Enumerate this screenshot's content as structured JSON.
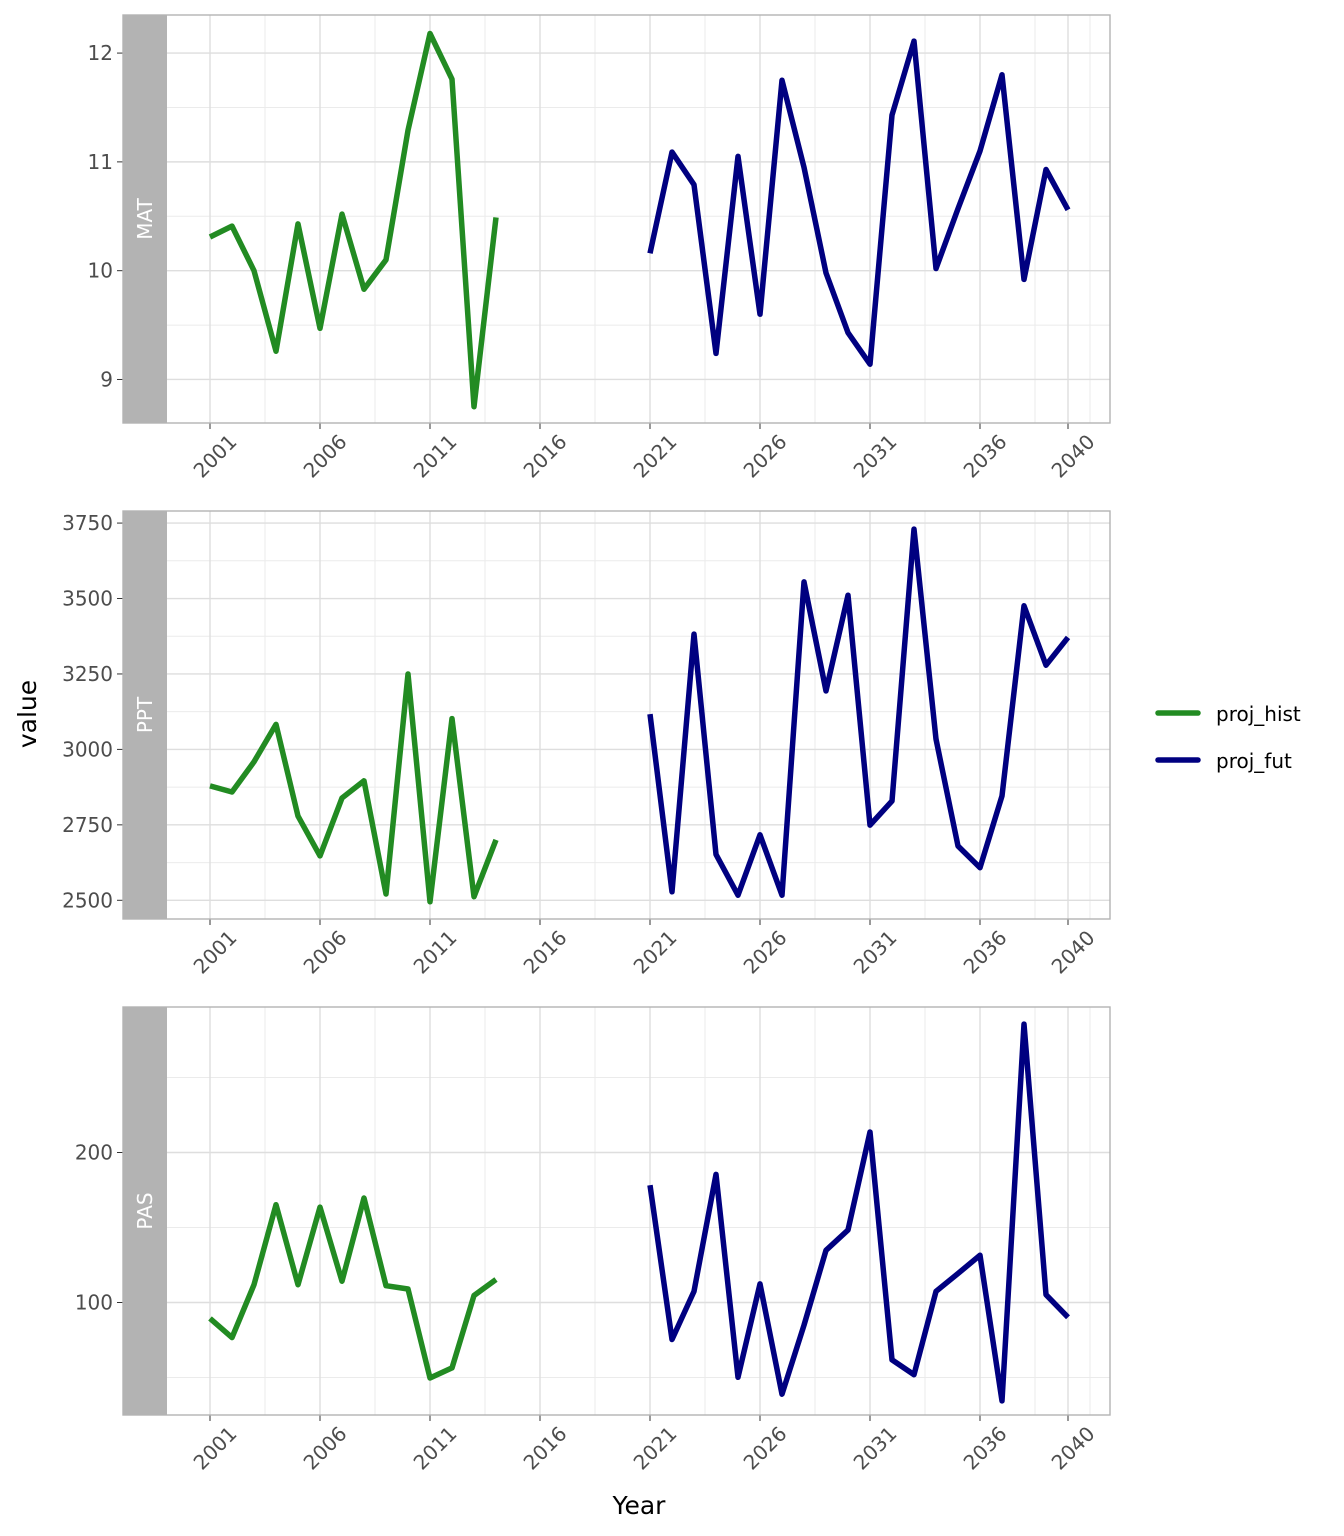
{
  "chart_data": {
    "type": "line",
    "facet_layout": "vertical",
    "xlabel": "Year",
    "ylabel": "value",
    "x_ticks": [
      2001,
      2006,
      2011,
      2016,
      2021,
      2026,
      2031,
      2036,
      2040
    ],
    "xlim": [
      1999,
      2041
    ],
    "grid": true,
    "legend": {
      "placement": "right",
      "entries": [
        {
          "name": "proj_hist",
          "color": "#228B22"
        },
        {
          "name": "proj_fut",
          "color": "#000080"
        }
      ]
    },
    "panels": [
      {
        "name": "MAT",
        "ylim": [
          8.6,
          12.35
        ],
        "y_ticks": [
          9,
          10,
          11,
          12
        ],
        "series": [
          {
            "name": "proj_hist",
            "color": "#228B22",
            "x": [
              2001,
              2002,
              2003,
              2004,
              2005,
              2006,
              2007,
              2008,
              2009,
              2010,
              2011,
              2012,
              2013,
              2014
            ],
            "values": [
              10.31,
              10.41,
              10.0,
              9.26,
              10.43,
              9.47,
              10.52,
              9.83,
              10.1,
              11.29,
              12.18,
              11.76,
              8.75,
              10.49
            ]
          },
          {
            "name": "proj_fut",
            "color": "#000080",
            "x": [
              2021,
              2022,
              2023,
              2024,
              2025,
              2026,
              2027,
              2028,
              2029,
              2030,
              2031,
              2032,
              2033,
              2034,
              2035,
              2036,
              2037,
              2038,
              2039,
              2040
            ],
            "values": [
              10.16,
              11.09,
              10.79,
              9.24,
              11.05,
              9.6,
              11.75,
              10.95,
              9.98,
              9.43,
              9.14,
              11.43,
              12.11,
              10.02,
              10.57,
              11.1,
              11.8,
              9.92,
              10.93,
              10.56
            ]
          }
        ]
      },
      {
        "name": "PPT",
        "ylim": [
          2438,
          3790
        ],
        "y_ticks": [
          2500,
          2750,
          3000,
          3250,
          3500,
          3750
        ],
        "series": [
          {
            "name": "proj_hist",
            "color": "#228B22",
            "x": [
              2001,
              2002,
              2003,
              2004,
              2005,
              2006,
              2007,
              2008,
              2009,
              2010,
              2011,
              2012,
              2013,
              2014
            ],
            "values": [
              2879,
              2859,
              2959,
              3083,
              2779,
              2647,
              2839,
              2896,
              2521,
              3250,
              2495,
              3102,
              2512,
              2700
            ]
          },
          {
            "name": "proj_fut",
            "color": "#000080",
            "x": [
              2021,
              2022,
              2023,
              2024,
              2025,
              2026,
              2027,
              2028,
              2029,
              2030,
              2031,
              2032,
              2033,
              2034,
              2035,
              2036,
              2037,
              2038,
              2039,
              2040
            ],
            "values": [
              3117,
              2528,
              3382,
              2652,
              2517,
              2717,
              2517,
              3555,
              3194,
              3511,
              2749,
              2829,
              3730,
              3034,
              2680,
              2608,
              2846,
              3476,
              3279,
              3371
            ]
          }
        ]
      },
      {
        "name": "PAS",
        "ylim": [
          25,
          297
        ],
        "y_ticks": [
          100,
          200
        ],
        "series": [
          {
            "name": "proj_hist",
            "color": "#228B22",
            "x": [
              2001,
              2002,
              2003,
              2004,
              2005,
              2006,
              2007,
              2008,
              2009,
              2010,
              2011,
              2012,
              2013,
              2014
            ],
            "values": [
              89.4,
              76.6,
              111.9,
              165.2,
              111.9,
              163.6,
              114.2,
              169.7,
              111.2,
              109.0,
              49.7,
              56.4,
              104.7,
              115.3
            ]
          },
          {
            "name": "proj_fut",
            "color": "#000080",
            "x": [
              2021,
              2022,
              2023,
              2024,
              2025,
              2026,
              2027,
              2028,
              2029,
              2030,
              2031,
              2032,
              2033,
              2034,
              2035,
              2036,
              2037,
              2038,
              2039,
              2040
            ],
            "values": [
              178.2,
              75.3,
              107.4,
              185.4,
              50.1,
              112.4,
              38.9,
              84.9,
              134.8,
              148.3,
              213.7,
              61.8,
              51.9,
              107.4,
              119.3,
              131.5,
              34.4,
              285.6,
              105.2,
              90.1
            ]
          }
        ]
      }
    ]
  }
}
